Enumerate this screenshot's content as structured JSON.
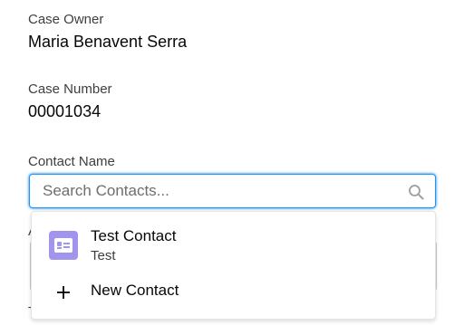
{
  "fields": {
    "case_owner": {
      "label": "Case Owner",
      "value": "Maria Benavent Serra"
    },
    "case_number": {
      "label": "Case Number",
      "value": "00001034"
    },
    "contact_name": {
      "label": "Contact Name"
    }
  },
  "search": {
    "placeholder": "Search Contacts...",
    "value": ""
  },
  "dropdown": {
    "results": [
      {
        "title": "Test Contact",
        "subtitle": "Test",
        "icon": "contact-card-icon"
      }
    ],
    "new_action": {
      "label": "New Contact",
      "icon": "plus-icon"
    }
  },
  "colors": {
    "focus_border": "#1b96ff",
    "contact_icon_bg": "#a094ed"
  }
}
